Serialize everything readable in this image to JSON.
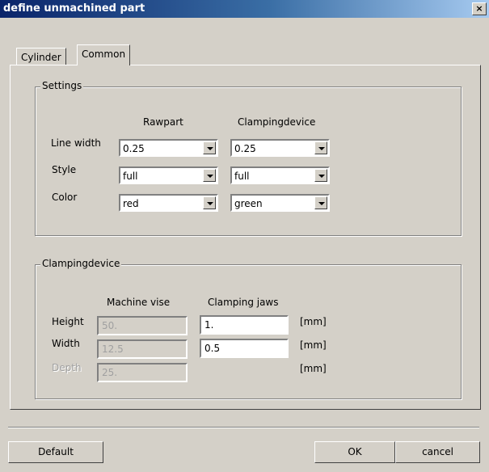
{
  "window": {
    "title": "define unmachined part",
    "close_glyph": "×"
  },
  "tabs": [
    {
      "label": "Cylinder",
      "active": false
    },
    {
      "label": "Common",
      "active": true
    }
  ],
  "settings": {
    "legend": "Settings",
    "col_rawpart": "Rawpart",
    "col_clamping": "Clampingdevice",
    "rows": [
      {
        "label": "Line width",
        "rawpart": "0.25",
        "clamping": "0.25"
      },
      {
        "label": "Style",
        "rawpart": "full",
        "clamping": "full"
      },
      {
        "label": "Color",
        "rawpart": "red",
        "clamping": "green"
      }
    ]
  },
  "clampingdevice": {
    "legend": "Clampingdevice",
    "col_vise": "Machine vise",
    "col_jaws": "Clamping jaws",
    "rows": [
      {
        "label": "Height",
        "vise": "50.",
        "jaws": "1.",
        "unit": "[mm]"
      },
      {
        "label": "Width",
        "vise": "12.5",
        "jaws": "0.5",
        "unit": "[mm]"
      },
      {
        "label": "Depth",
        "vise": "25.",
        "unit": "[mm]"
      }
    ]
  },
  "buttons": {
    "default": "Default",
    "ok": "OK",
    "cancel": "cancel"
  }
}
